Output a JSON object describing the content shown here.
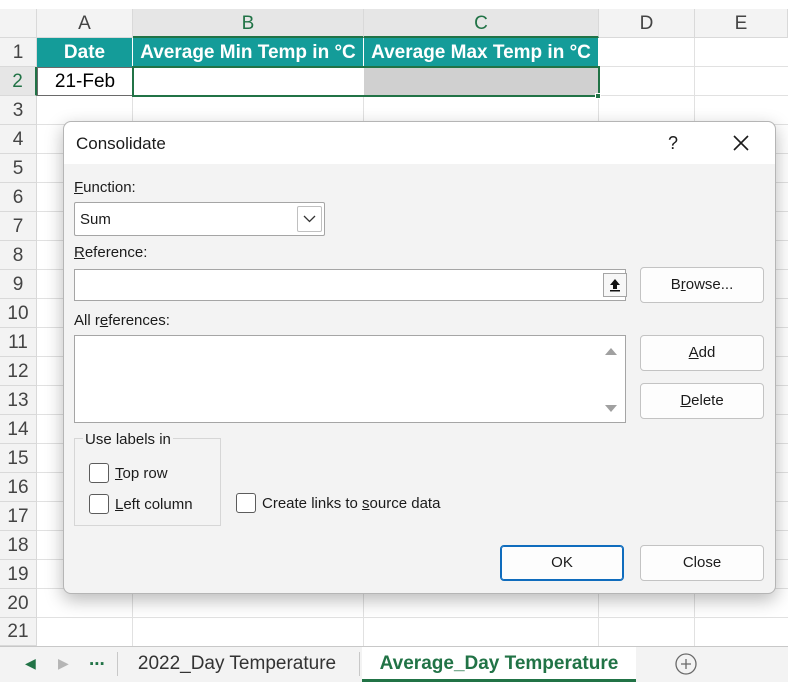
{
  "grid": {
    "columns": [
      "A",
      "B",
      "C",
      "D",
      "E"
    ],
    "rows": [
      "1",
      "2",
      "3",
      "4",
      "5",
      "6",
      "7",
      "8",
      "9",
      "10",
      "11",
      "12",
      "13",
      "14",
      "15",
      "16",
      "17",
      "18",
      "19",
      "20",
      "21"
    ],
    "cells": {
      "A1": "Date",
      "B1": "Average Min Temp in °C",
      "C1": "Average Max Temp in °C",
      "A2": "21-Feb"
    },
    "colors": {
      "header_fill": "#149c99",
      "header_text": "#ffffff",
      "selection": "#217346",
      "selected_fill": "#d0d0d0"
    }
  },
  "dialog": {
    "title": "Consolidate",
    "help": "?",
    "function_label_key": "F",
    "function_label_rest": "unction:",
    "function_value": "Sum",
    "reference_label_key": "R",
    "reference_label_rest": "eference:",
    "reference_value": "",
    "all_refs_label_pre": "All r",
    "all_refs_label_key": "e",
    "all_refs_label_post": "ferences:",
    "browse_pre": "B",
    "browse_key": "r",
    "browse_post": "owse...",
    "add_key": "A",
    "add_rest": "dd",
    "delete_key": "D",
    "delete_rest": "elete",
    "use_labels_title": "Use labels in",
    "top_row_key": "T",
    "top_row_rest": "op row",
    "left_column_key": "L",
    "left_column_rest": "eft column",
    "create_links_pre": "Create links to ",
    "create_links_key": "s",
    "create_links_post": "ource data",
    "ok_label": "OK",
    "close_label": "Close"
  },
  "sheet_tabs": {
    "ellipsis": "...",
    "tabs": [
      {
        "label": "2022_Day Temperature",
        "active": false
      },
      {
        "label": "Average_Day Temperature",
        "active": true
      }
    ]
  }
}
